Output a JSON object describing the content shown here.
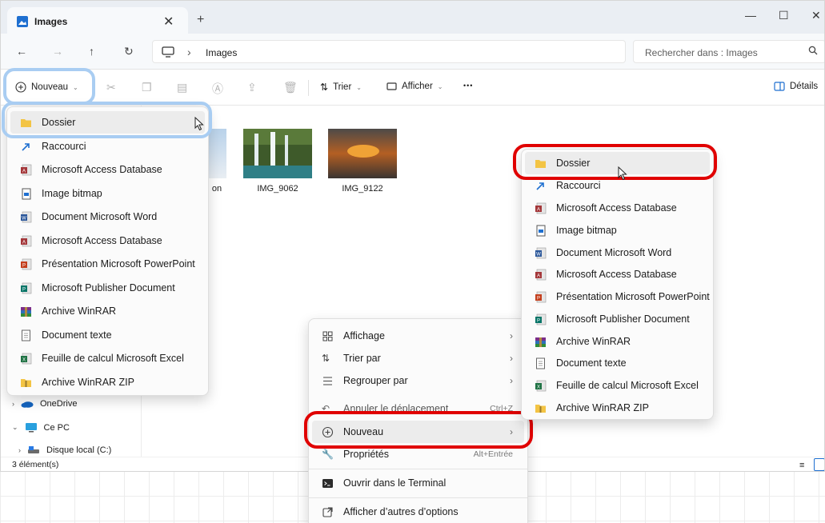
{
  "tab": {
    "title": "Images",
    "close": "✕",
    "new": "+"
  },
  "window_controls": {
    "minimize": "—",
    "maximize": "☐",
    "close": "✕"
  },
  "nav": {
    "back": "←",
    "forward": "→",
    "up": "↑",
    "refresh": "↻"
  },
  "address": {
    "separator": "›",
    "location": "Images"
  },
  "search": {
    "placeholder": "Rechercher dans : Images"
  },
  "commandbar": {
    "new_label": "Nouveau",
    "sort_label": "Trier",
    "view_label": "Afficher",
    "more": "•••",
    "details_label": "Détails"
  },
  "files": [
    {
      "name": "on"
    },
    {
      "name": "IMG_9062"
    },
    {
      "name": "IMG_9122"
    }
  ],
  "sidebar": {
    "items": [
      {
        "label": "OneDrive"
      },
      {
        "label": "Ce PC"
      },
      {
        "label": "Disque local (C:)"
      }
    ]
  },
  "status": {
    "count": "3 élément(s)"
  },
  "new_menu_left": {
    "items": [
      {
        "label": "Dossier",
        "icon": "folder-icon"
      },
      {
        "label": "Raccourci",
        "icon": "shortcut-icon"
      },
      {
        "label": "Microsoft Access Database",
        "icon": "access-icon"
      },
      {
        "label": "Image bitmap",
        "icon": "bitmap-icon"
      },
      {
        "label": "Document Microsoft Word",
        "icon": "word-icon"
      },
      {
        "label": "Microsoft Access Database",
        "icon": "access-icon"
      },
      {
        "label": "Présentation Microsoft PowerPoint",
        "icon": "powerpoint-icon"
      },
      {
        "label": "Microsoft Publisher Document",
        "icon": "publisher-icon"
      },
      {
        "label": "Archive WinRAR",
        "icon": "winrar-icon"
      },
      {
        "label": "Document texte",
        "icon": "text-document-icon"
      },
      {
        "label": "Feuille de calcul Microsoft Excel",
        "icon": "excel-icon"
      },
      {
        "label": "Archive WinRAR ZIP",
        "icon": "winrar-zip-icon"
      }
    ]
  },
  "context_menu": {
    "items": [
      {
        "label": "Affichage",
        "chevron": "›"
      },
      {
        "label": "Trier par",
        "chevron": "›"
      },
      {
        "label": "Regrouper par",
        "chevron": "›"
      },
      {
        "label": "Annuler le déplacement",
        "shortcut": "Ctrl+Z"
      },
      {
        "label": "Nouveau",
        "chevron": "›"
      },
      {
        "label": "Propriétés",
        "shortcut": "Alt+Entrée"
      },
      {
        "label": "Ouvrir dans le Terminal"
      },
      {
        "label": "Afficher d’autres d’options"
      }
    ]
  },
  "new_submenu": {
    "items": [
      {
        "label": "Dossier"
      },
      {
        "label": "Raccourci"
      },
      {
        "label": "Microsoft Access Database"
      },
      {
        "label": "Image bitmap"
      },
      {
        "label": "Document Microsoft Word"
      },
      {
        "label": "Microsoft Access Database"
      },
      {
        "label": "Présentation Microsoft PowerPoint"
      },
      {
        "label": "Microsoft Publisher Document"
      },
      {
        "label": "Archive WinRAR"
      },
      {
        "label": "Document texte"
      },
      {
        "label": "Feuille de calcul Microsoft Excel"
      },
      {
        "label": "Archive WinRAR ZIP"
      }
    ]
  },
  "colors": {
    "highlight_blue": "#a9cdf2",
    "highlight_red": "#e00000",
    "folder": "#f3c444"
  }
}
